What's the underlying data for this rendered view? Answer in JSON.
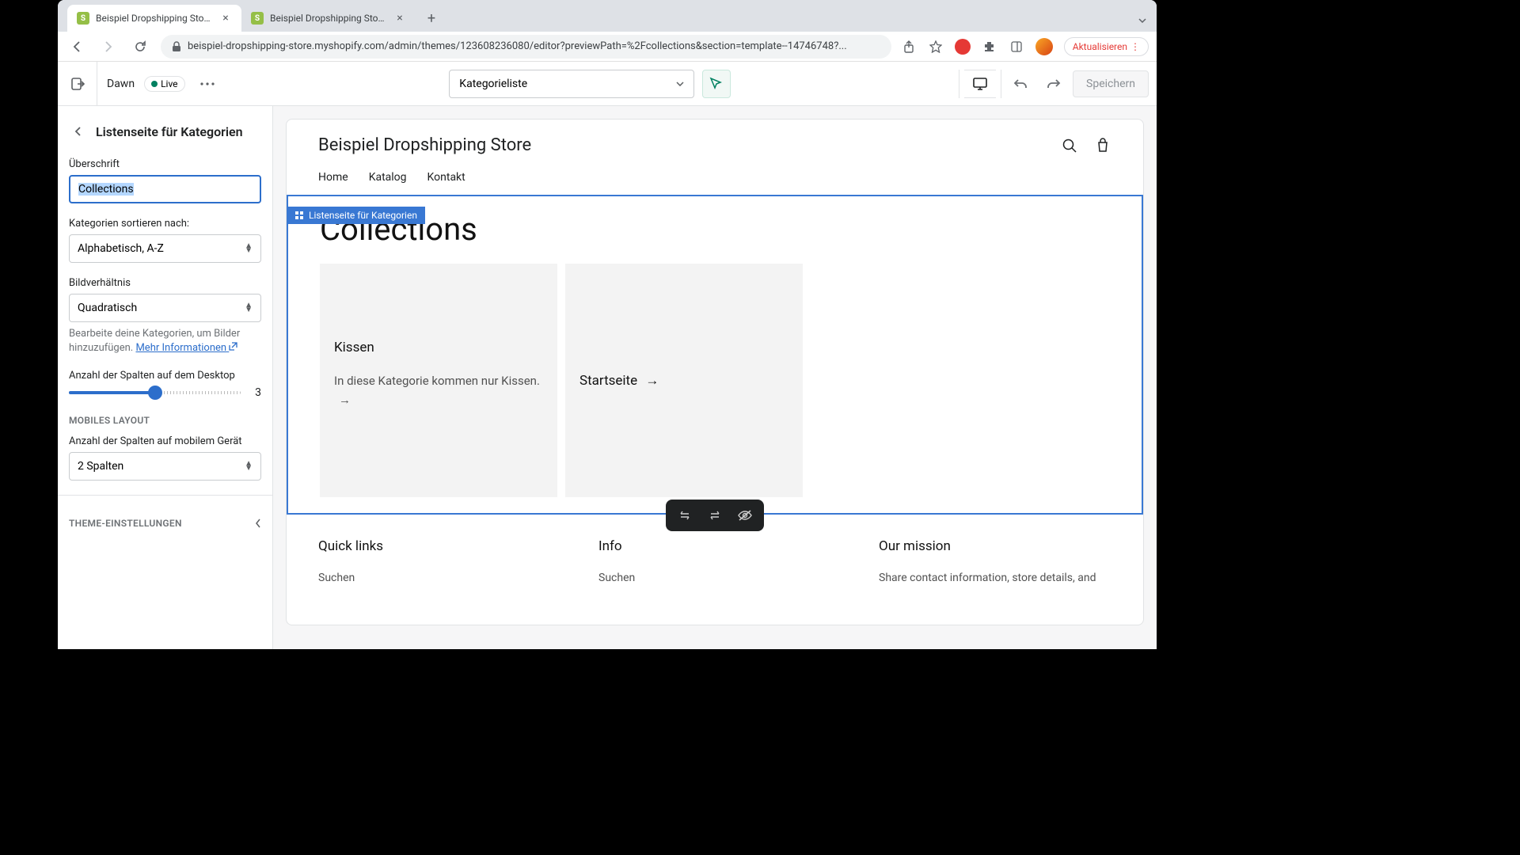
{
  "browser": {
    "tabs": [
      {
        "title": "Beispiel Dropshipping Store · D"
      },
      {
        "title": "Beispiel Dropshipping Store · E"
      }
    ],
    "url": "beispiel-dropshipping-store.myshopify.com/admin/themes/123608236080/editor?previewPath=%2Fcollections&section=template--14746748?...",
    "refresh_label": "Aktualisieren"
  },
  "topbar": {
    "theme_name": "Dawn",
    "live_label": "Live",
    "page_selector": "Kategorieliste",
    "save_label": "Speichern"
  },
  "sidebar": {
    "title": "Listenseite für Kategorien",
    "heading_label": "Überschrift",
    "heading_value": "Collections",
    "sort_label": "Kategorien sortieren nach:",
    "sort_value": "Alphabetisch, A-Z",
    "ratio_label": "Bildverhältnis",
    "ratio_value": "Quadratisch",
    "ratio_help_pre": "Bearbeite deine Kategorien, um Bilder hinzuzufügen. ",
    "ratio_help_link": "Mehr Informationen",
    "desktop_cols_label": "Anzahl der Spalten auf dem Desktop",
    "desktop_cols_value": "3",
    "mobile_section": "MOBILES LAYOUT",
    "mobile_cols_label": "Anzahl der Spalten auf mobilem Gerät",
    "mobile_cols_value": "2 Spalten",
    "theme_settings": "THEME-EINSTELLUNGEN"
  },
  "preview": {
    "store_name": "Beispiel Dropshipping Store",
    "nav": [
      "Home",
      "Katalog",
      "Kontakt"
    ],
    "section_label": "Listenseite für Kategorien",
    "page_heading": "Collections",
    "cards": [
      {
        "title": "Kissen",
        "desc": "In diese Kategorie kommen nur Kissen."
      },
      {
        "title": "Startseite"
      }
    ],
    "footer": {
      "cols": [
        {
          "head": "Quick links",
          "link": "Suchen"
        },
        {
          "head": "Info",
          "link": "Suchen"
        },
        {
          "head": "Our mission",
          "link": "Share contact information, store details, and"
        }
      ]
    }
  }
}
